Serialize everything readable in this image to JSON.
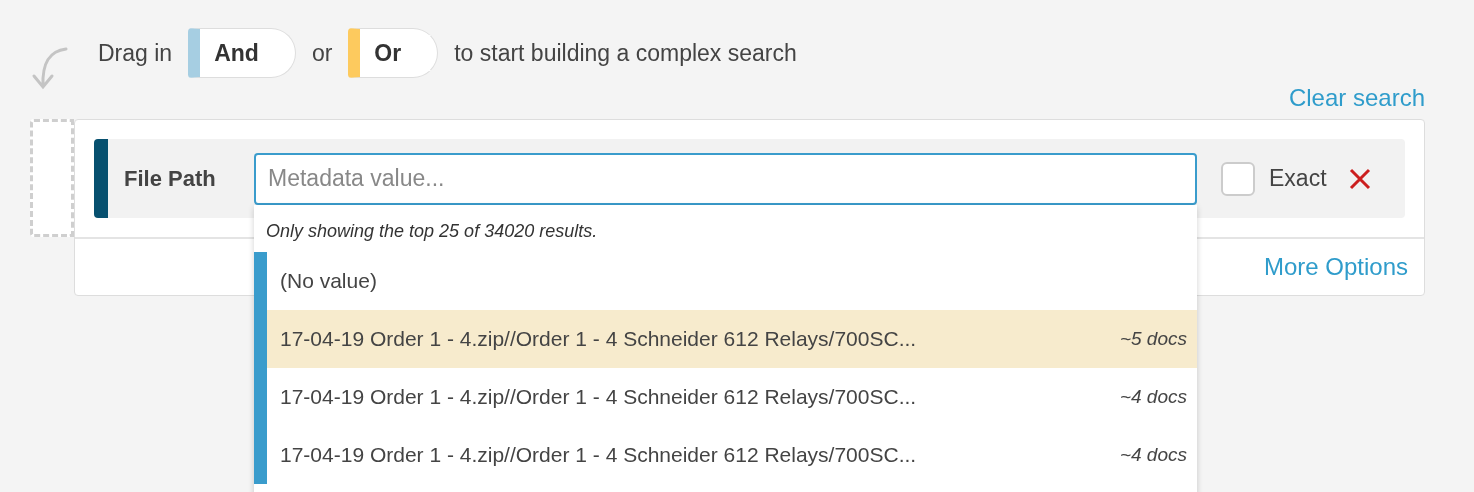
{
  "hint": {
    "parts": [
      {
        "kind": "text",
        "text": "Drag in"
      },
      {
        "kind": "chip",
        "label": "And",
        "color": "#a6cee2"
      },
      {
        "kind": "text",
        "text": "or"
      },
      {
        "kind": "chip",
        "label": "Or",
        "color": "#fdca5e"
      },
      {
        "kind": "text",
        "text": "to start building a complex search"
      }
    ]
  },
  "clear_search": "Clear search",
  "condition": {
    "field": "File Path",
    "placeholder": "Metadata value...",
    "exact": {
      "label": "Exact",
      "checked": false
    }
  },
  "more_options": "More Options",
  "dropdown": {
    "note": "Only showing the top 25 of 34020 results.",
    "items": [
      {
        "label": "(No value)",
        "selected": false
      },
      {
        "label": "17-04-19 Order 1 - 4.zip//Order 1 - 4 Schneider 612 Relays/700SC...",
        "count": "~5 docs",
        "selected": true
      },
      {
        "label": "17-04-19 Order 1 - 4.zip//Order 1 - 4 Schneider 612 Relays/700SC...",
        "count": "~4 docs",
        "selected": false
      },
      {
        "label": "17-04-19 Order 1 - 4.zip//Order 1 - 4 Schneider 612 Relays/700SC...",
        "count": "~4 docs",
        "selected": false
      }
    ]
  }
}
